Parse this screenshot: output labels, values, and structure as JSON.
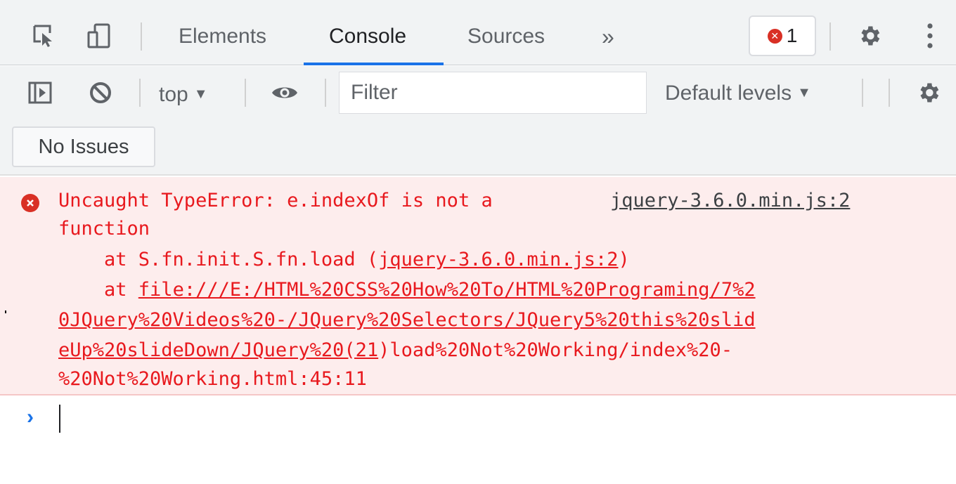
{
  "tabbar": {
    "tabs": [
      {
        "label": "Elements",
        "active": false
      },
      {
        "label": "Console",
        "active": true
      },
      {
        "label": "Sources",
        "active": false
      }
    ],
    "more_tabs_glyph": "»",
    "error_count": "1",
    "icons": [
      "inspect-element-icon",
      "device-toolbar-icon",
      "settings-gear-icon",
      "kebab-menu-icon"
    ]
  },
  "toolbar": {
    "context": "top",
    "filter_placeholder": "Filter",
    "levels": "Default levels",
    "icons": [
      "sidebar-toggle-icon",
      "clear-console-icon",
      "live-expression-eye-icon",
      "console-settings-gear-icon"
    ]
  },
  "issues": {
    "label": "No Issues"
  },
  "error": {
    "message_line1": "Uncaught TypeError: e.indexOf is not a",
    "message_line2": "function",
    "source_link": "jquery-3.6.0.min.js:2",
    "stack1_prefix": "    at S.fn.init.S.fn.load (",
    "stack1_link": "jquery-3.6.0.min.js:2",
    "stack1_suffix": ")",
    "stack2_prefix": "    at ",
    "stack2_link_line1": "file:///E:/HTML%20CSS%20How%20To/HTML%20Programing/7%2",
    "stack2_link_line2": "0JQuery%20Videos%20-/JQuery%20Selectors/JQuery5%20this%20slid",
    "stack2_link_line3": "eUp%20slideDown/JQuery%20(21",
    "stack2_line3_rest": ")load%20Not%20Working/index%20-",
    "stack2_line4": "%20Not%20Working.html:45:11"
  },
  "prompt": {
    "glyph": "›"
  },
  "colors": {
    "error_text": "#e8191e",
    "error_bg": "#fdeded",
    "accent": "#1a73e8",
    "toolbar_bg": "#f1f3f4"
  }
}
